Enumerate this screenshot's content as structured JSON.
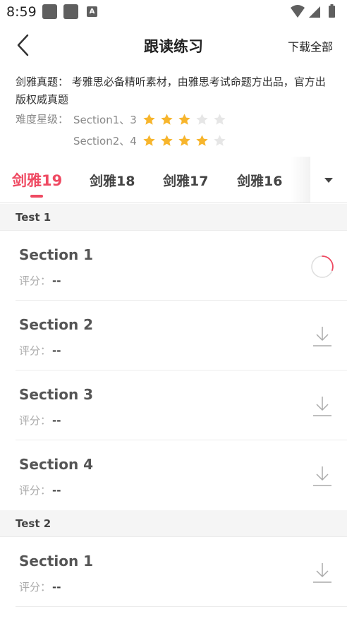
{
  "status_bar": {
    "time": "8:59",
    "notif_letter": "A"
  },
  "nav": {
    "title": "跟读练习",
    "download_all": "下载全部"
  },
  "description": "剑雅真题： 考雅思必备精听素材，由雅思考试命题方出品，官方出版权威真题",
  "difficulty": {
    "label": "难度星级：",
    "rows": [
      {
        "text": "Section1、3",
        "stars": 3,
        "max": 5
      },
      {
        "text": "Section2、4",
        "stars": 4,
        "max": 5
      }
    ]
  },
  "tabs": [
    {
      "label": "剑雅19",
      "active": true
    },
    {
      "label": "剑雅18",
      "active": false
    },
    {
      "label": "剑雅17",
      "active": false
    },
    {
      "label": "剑雅16",
      "active": false
    }
  ],
  "groups": [
    {
      "title": "Test 1",
      "sections": [
        {
          "title": "Section 1",
          "score_label": "评分：",
          "score": "--",
          "state": "loading"
        },
        {
          "title": "Section 2",
          "score_label": "评分：",
          "score": "--",
          "state": "download"
        },
        {
          "title": "Section 3",
          "score_label": "评分：",
          "score": "--",
          "state": "download"
        },
        {
          "title": "Section 4",
          "score_label": "评分：",
          "score": "--",
          "state": "download"
        }
      ]
    },
    {
      "title": "Test 2",
      "sections": [
        {
          "title": "Section 1",
          "score_label": "评分：",
          "score": "--",
          "state": "download"
        }
      ]
    }
  ],
  "colors": {
    "accent": "#ef4a62",
    "star_on": "#f7b52c",
    "star_off": "#e6e6e6"
  }
}
